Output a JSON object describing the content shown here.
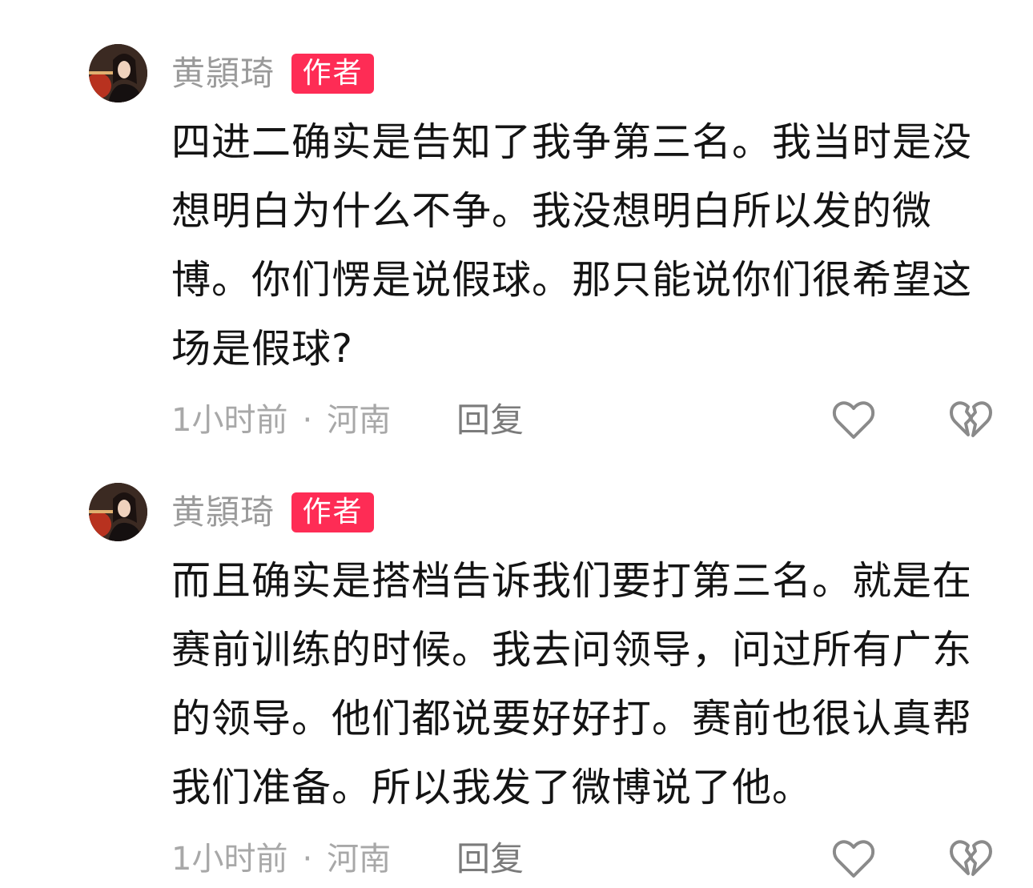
{
  "comments": [
    {
      "author": "黄頴琦",
      "badge": "作者",
      "text": "四进二确实是告知了我争第三名。我当时是没想明白为什么不争。我没想明白所以发的微博。你们愣是说假球。那只能说你们很希望这场是假球?",
      "time": "1小时前",
      "separator": "·",
      "location": "河南",
      "reply_label": "回复",
      "like_icon": "heart-outline-icon",
      "dislike_icon": "broken-heart-outline-icon"
    },
    {
      "author": "黄頴琦",
      "badge": "作者",
      "text": "而且确实是搭档告诉我们要打第三名。就是在赛前训练的时候。我去问领导，问过所有广东的领导。他们都说要好好打。赛前也很认真帮我们准备。所以我发了微博说了他。",
      "time": "1小时前",
      "separator": "·",
      "location": "河南",
      "reply_label": "回复",
      "like_icon": "heart-outline-icon",
      "dislike_icon": "broken-heart-outline-icon"
    }
  ],
  "colors": {
    "badge": "#fe2c55",
    "author_name": "#9a9a9a",
    "meta": "#a8a8a8",
    "icon_stroke": "#8a8a8a"
  }
}
